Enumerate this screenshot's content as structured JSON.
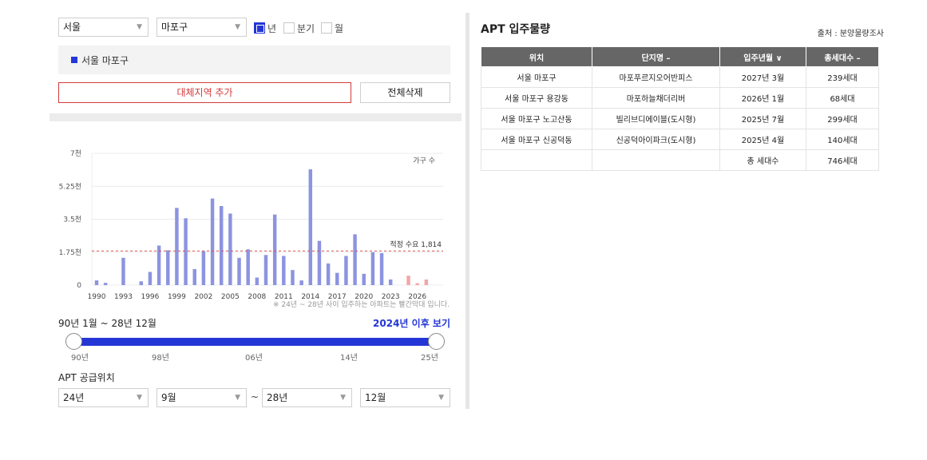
{
  "filters": {
    "city": "서울",
    "district": "마포구",
    "period_options": [
      {
        "label": "년",
        "checked": true
      },
      {
        "label": "분기",
        "checked": false
      },
      {
        "label": "월",
        "checked": false
      }
    ]
  },
  "selected_region": "서울 마포구",
  "buttons": {
    "add_region": "대체지역 추가",
    "delete_all": "전체삭제"
  },
  "chart_data": {
    "type": "bar",
    "legend": "가구 수",
    "ytick_labels": [
      "7천",
      "5.25천",
      "3.5천",
      "1.75천",
      "0"
    ],
    "yticks": [
      7000,
      5250,
      3500,
      1750,
      0
    ],
    "ylim": [
      0,
      7000
    ],
    "xtick_labels": [
      "1990",
      "1993",
      "1996",
      "1999",
      "2002",
      "2005",
      "2008",
      "2011",
      "2014",
      "2017",
      "2020",
      "2023",
      "2026"
    ],
    "reference_line": {
      "label": "적정 수요 1,814",
      "value": 1814
    },
    "note": "※ 24년 ~ 28년 사이 입주하는 아파트는 빨간막대 입니다.",
    "x": [
      1990,
      1991,
      1992,
      1993,
      1994,
      1995,
      1996,
      1997,
      1998,
      1999,
      2000,
      2001,
      2002,
      2003,
      2004,
      2005,
      2006,
      2007,
      2008,
      2009,
      2010,
      2011,
      2012,
      2013,
      2014,
      2015,
      2016,
      2017,
      2018,
      2019,
      2020,
      2021,
      2022,
      2023,
      2024,
      2025,
      2026,
      2027,
      2028
    ],
    "values": [
      250,
      120,
      0,
      1450,
      0,
      200,
      700,
      2100,
      1850,
      4100,
      3550,
      850,
      1800,
      4600,
      4200,
      3800,
      1450,
      1900,
      400,
      1600,
      3750,
      1550,
      800,
      250,
      6150,
      2350,
      1150,
      650,
      1550,
      2700,
      600,
      1750,
      1700,
      300,
      0,
      500,
      100,
      299,
      0
    ],
    "red_from_year": 2024
  },
  "range": {
    "title": "90년 1월 ~ 28년 12월",
    "link": "2024년 이후 보기",
    "ticks": [
      "90년",
      "98년",
      "06년",
      "14년",
      "25년"
    ]
  },
  "supply": {
    "label": "APT 공급위치",
    "from_year": "24년",
    "from_month": "9월",
    "to_year": "28년",
    "to_month": "12월",
    "separator": "~"
  },
  "table": {
    "title": "APT 입주물량",
    "source": "출처 : 분양물량조사",
    "headers": [
      "위치",
      "단지명 –",
      "입주년월 ∨",
      "총세대수 –"
    ],
    "rows": [
      [
        "서울 마포구",
        "마포푸르지오어반피스",
        "2027년 3월",
        "239세대"
      ],
      [
        "서울 마포구 용강동",
        "마포하늘채더리버",
        "2026년 1월",
        "68세대"
      ],
      [
        "서울 마포구 노고산동",
        "빌리브디에이블(도시형)",
        "2025년 7월",
        "299세대"
      ],
      [
        "서울 마포구 신공덕동",
        "신공덕아이파크(도시형)",
        "2025년 4월",
        "140세대"
      ]
    ],
    "total_label": "총 세대수",
    "total_value": "746세대"
  },
  "colors": {
    "accent": "#2436d6",
    "bar": "#8c94e0",
    "bar_red": "#f2a6a6",
    "ref_line": "#e05050",
    "add_button": "#d43b3b"
  }
}
